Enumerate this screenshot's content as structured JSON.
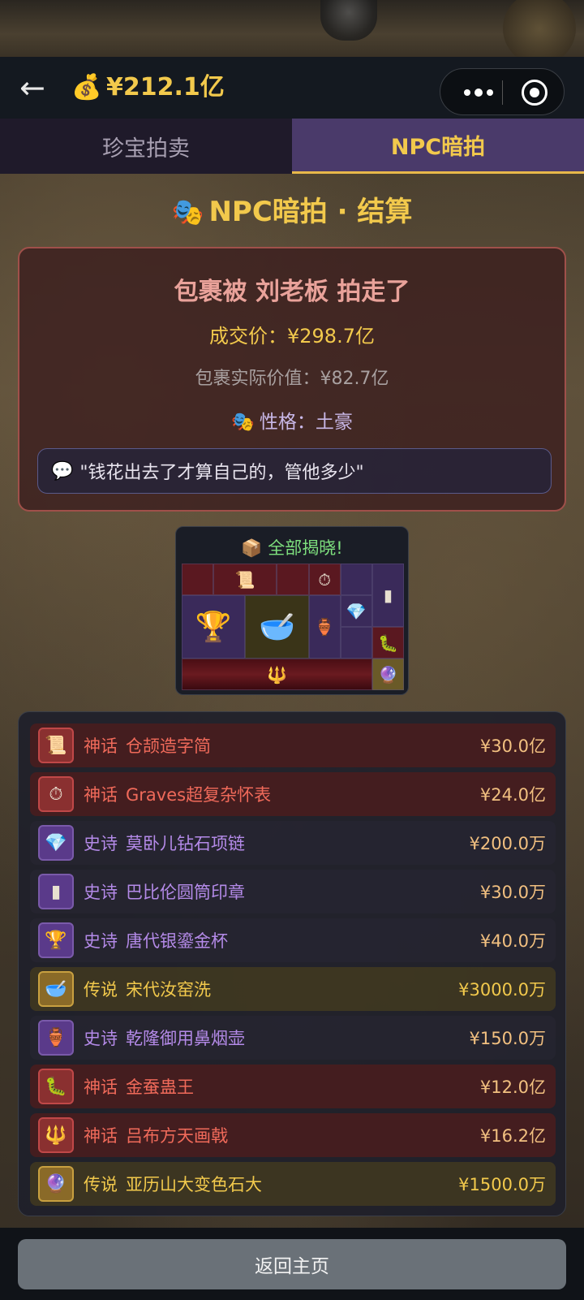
{
  "header": {
    "back_icon": "←",
    "money_icon": "💰",
    "balance": "¥212.1亿"
  },
  "tabs": [
    {
      "label": "珍宝拍卖",
      "active": false
    },
    {
      "label": "NPC暗拍",
      "active": true
    }
  ],
  "section": {
    "mask_icon": "🎭",
    "title": "NPC暗拍 · 结算"
  },
  "result": {
    "headline": "包裹被 刘老板 拍走了",
    "deal_price": "成交价：¥298.7亿",
    "actual_value": "包裹实际价值：¥82.7亿",
    "persona_icon": "🎭",
    "persona": "性格：土豪",
    "quote_icon": "💬",
    "quote": "\"钱花出去了才算自己的，管他多少\""
  },
  "reveal": {
    "title_icon": "📦",
    "title": "全部揭晓!"
  },
  "items": [
    {
      "rarity": "神话",
      "name": "仓颉造字简",
      "price": "¥30.0亿",
      "tier": "myth",
      "icon": "📜",
      "icon_name": "bamboo-scroll-icon"
    },
    {
      "rarity": "神话",
      "name": "Graves超复杂怀表",
      "price": "¥24.0亿",
      "tier": "myth",
      "icon": "⏱",
      "icon_name": "pocket-watch-icon"
    },
    {
      "rarity": "史诗",
      "name": "莫卧儿钻石项链",
      "price": "¥200.0万",
      "tier": "epic",
      "icon": "💎",
      "icon_name": "necklace-icon"
    },
    {
      "rarity": "史诗",
      "name": "巴比伦圆筒印章",
      "price": "¥30.0万",
      "tier": "epic",
      "icon": "▮",
      "icon_name": "cylinder-seal-icon"
    },
    {
      "rarity": "史诗",
      "name": "唐代银鎏金杯",
      "price": "¥40.0万",
      "tier": "epic",
      "icon": "🏆",
      "icon_name": "goblet-icon"
    },
    {
      "rarity": "传说",
      "name": "宋代汝窑洗",
      "price": "¥3000.0万",
      "tier": "legend",
      "icon": "🥣",
      "icon_name": "porcelain-bowl-icon"
    },
    {
      "rarity": "史诗",
      "name": "乾隆御用鼻烟壶",
      "price": "¥150.0万",
      "tier": "epic",
      "icon": "🏺",
      "icon_name": "snuff-bottle-icon"
    },
    {
      "rarity": "神话",
      "name": "金蚕蛊王",
      "price": "¥12.0亿",
      "tier": "myth",
      "icon": "🐛",
      "icon_name": "golden-silkworm-icon"
    },
    {
      "rarity": "神话",
      "name": "吕布方天画戟",
      "price": "¥16.2亿",
      "tier": "myth",
      "icon": "🔱",
      "icon_name": "halberd-icon"
    },
    {
      "rarity": "传说",
      "name": "亚历山大变色石大",
      "price": "¥1500.0万",
      "tier": "legend",
      "icon": "🔮",
      "icon_name": "alexandrite-gem-icon"
    }
  ],
  "footer": {
    "home_label": "返回主页"
  },
  "colors": {
    "gold": "#f2c94c",
    "myth": "#f06a5a",
    "epic": "#b48ae8",
    "tab_active_bg": "#4a3a6a"
  }
}
